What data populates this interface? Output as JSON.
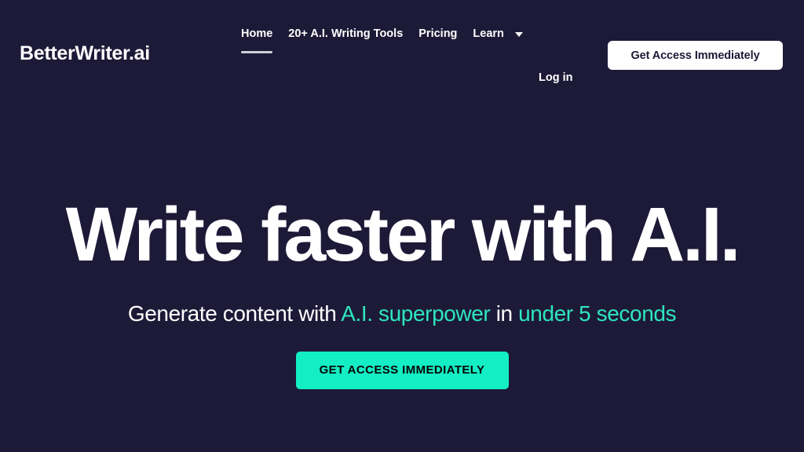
{
  "theme": {
    "background": "#1d1a38",
    "accent": "#2ee6be",
    "cta_background": "#14eec5",
    "cta_text": "#050505",
    "text": "#ffffff"
  },
  "header": {
    "logo": "BetterWriter.ai",
    "nav": [
      {
        "label": "Home",
        "active": true,
        "caret": false
      },
      {
        "label": "20+ A.I. Writing Tools",
        "active": false,
        "caret": false
      },
      {
        "label": "Pricing",
        "active": false,
        "caret": false
      },
      {
        "label": "Learn",
        "active": false,
        "caret": true
      }
    ],
    "login_label": "Log in",
    "cta_label": "Get Access Immediately"
  },
  "hero": {
    "title": "Write faster with A.I.",
    "subtitle": {
      "part1": "Generate content with ",
      "accent1": "A.I. superpower",
      "part2": " in ",
      "accent2": "under 5 seconds"
    },
    "cta_label": "GET ACCESS IMMEDIATELY"
  }
}
